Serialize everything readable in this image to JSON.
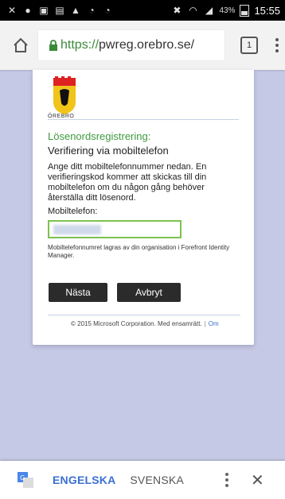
{
  "status_bar": {
    "time": "15:55",
    "battery": "43%",
    "icons": [
      "missed-call-icon",
      "record-icon",
      "image-icon",
      "calendar-icon",
      "alert-icon",
      "chat-icon",
      "chat-icon-2",
      "mute-icon",
      "wifi-icon",
      "signal-icon"
    ]
  },
  "browser": {
    "url_scheme": "https://",
    "url_host": "pwreg.orebro.se/",
    "tab_count": "1"
  },
  "card": {
    "logo_word": "ÖREBRO",
    "title": "Lösenordsregistrering:",
    "subtitle": "Verifiering via mobiltelefon",
    "description": "Ange ditt mobiltelefonnummer nedan. En verifieringskod kommer att skickas till din mobiltelefon om du någon gång behöver återställa ditt lösenord.",
    "phone_label": "Mobiltelefon:",
    "phone_note": "Mobiltelefonnumret lagras av din organisation i Forefront Identity Manager.",
    "next_button": "Nästa",
    "cancel_button": "Avbryt",
    "footer_text": "© 2015 Microsoft Corporation. Med ensamrätt.",
    "footer_link": "Om"
  },
  "translate_bar": {
    "lang_from": "ENGELSKA",
    "lang_to": "SVENSKA"
  },
  "colors": {
    "background": "#c5c9e6",
    "accent_green": "#3e9a3e",
    "link_blue": "#3b6fd4",
    "button_dark": "#2b2b2b"
  }
}
